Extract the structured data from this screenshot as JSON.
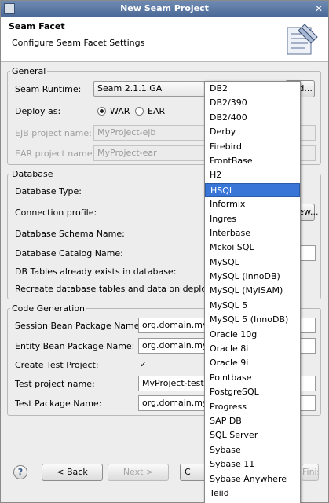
{
  "window": {
    "title": "New Seam Project"
  },
  "header": {
    "title": "Seam Facet",
    "subtitle": "Configure Seam Facet Settings"
  },
  "general": {
    "legend": "General",
    "runtime_label": "Seam Runtime:",
    "runtime_value": "Seam 2.1.1.GA",
    "add_button": "Add...",
    "deploy_label": "Deploy as:",
    "war_label": "WAR",
    "ear_label": "EAR",
    "deploy_selected": "WAR",
    "ejb_label": "EJB project name:",
    "ejb_value": "MyProject-ejb",
    "ear_project_label": "EAR project name:",
    "ear_value": "MyProject-ear"
  },
  "database": {
    "legend": "Database",
    "type_label": "Database Type:",
    "profile_label": "Connection profile:",
    "profile_button": "New...",
    "schema_label": "Database Schema Name:",
    "catalog_label": "Database Catalog Name:",
    "exists_label": "DB Tables already exists in database:",
    "recreate_label": "Recreate database tables and data on deploy:"
  },
  "codegen": {
    "legend": "Code Generation",
    "session_label": "Session Bean Package Name:",
    "session_value": "org.domain.my",
    "entity_label": "Entity Bean Package Name:",
    "entity_value": "org.domain.my",
    "create_test_label": "Create Test Project:",
    "create_test_checked": true,
    "create_test_mark": "✓",
    "test_project_label": "Test project name:",
    "test_project_value": "MyProject-test",
    "test_package_label": "Test Package Name:",
    "test_package_value": "org.domain.my"
  },
  "buttons": {
    "help": "?",
    "back": "< Back",
    "next": "Next >",
    "cancel": "C",
    "finish": "Finish"
  },
  "dropdown": {
    "selected": "HSQL",
    "items": [
      "DB2",
      "DB2/390",
      "DB2/400",
      "Derby",
      "Firebird",
      "FrontBase",
      "H2",
      "HSQL",
      "Informix",
      "Ingres",
      "Interbase",
      "Mckoi SQL",
      "MySQL",
      "MySQL (InnoDB)",
      "MySQL (MyISAM)",
      "MySQL 5",
      "MySQL 5 (InnoDB)",
      "Oracle 10g",
      "Oracle 8i",
      "Oracle 9i",
      "Pointbase",
      "PostgreSQL",
      "Progress",
      "SAP DB",
      "SQL Server",
      "Sybase",
      "Sybase 11",
      "Sybase Anywhere",
      "Teiid"
    ]
  }
}
